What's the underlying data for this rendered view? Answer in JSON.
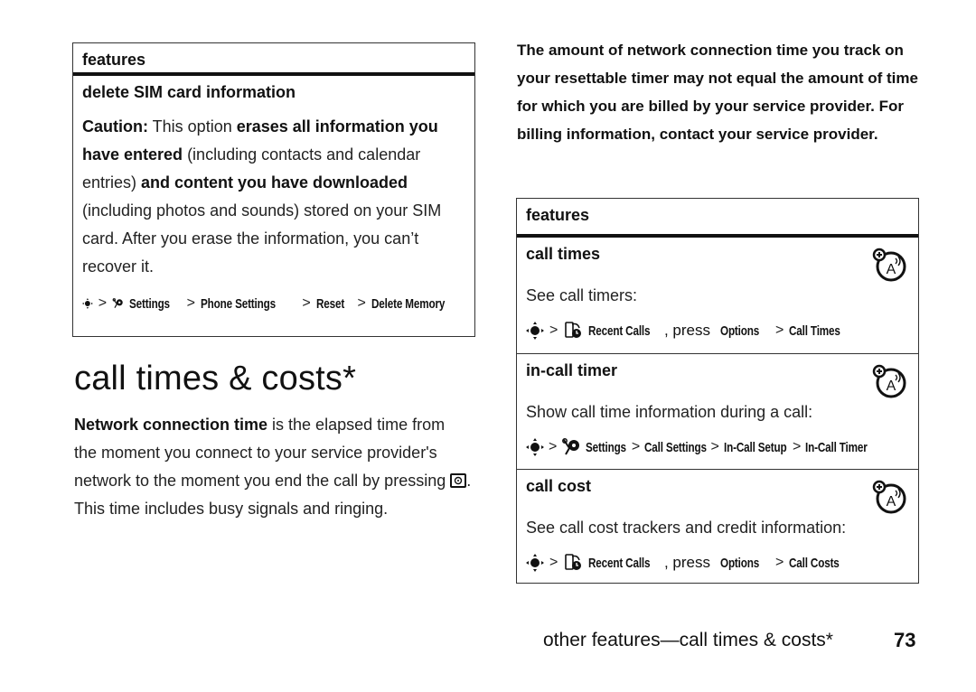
{
  "left_box": {
    "header": "features",
    "item_title": "delete SIM card information",
    "caution_label": "Caution:",
    "text_1": " This option ",
    "bold_1": "erases all information you have entered",
    "text_2": " (including contacts and calendar entries) ",
    "bold_2": "and content you have downloaded",
    "text_3": " (including photos and sounds) stored on your SIM card. After you erase the information, you can’t recover it.",
    "path": [
      "Settings",
      "Phone Settings",
      "Reset",
      "Delete Memory"
    ],
    "path_icons": [
      "nav-key-icon",
      "settings-icon"
    ]
  },
  "section": {
    "title": "call times & costs*",
    "intro_bold": "Network connection time",
    "intro_text_1": " is the elapsed time from the moment you connect to your service provider's network to the moment you end the call by pressing ",
    "intro_key_icon": "end-key-icon",
    "intro_text_2": ". This time includes busy signals and ringing."
  },
  "note": "The amount of network connection time you track on your resettable timer may not equal the amount of time for which you are billed by your service provider. For billing information, contact your service provider.",
  "right_box": {
    "header": "features",
    "rows": [
      {
        "title": "call times",
        "desc": "See call timers:",
        "icon": "network-dependent-icon",
        "path_lead_icon": "recent-calls-icon",
        "path_first": "Recent Calls",
        "press": ", press ",
        "path_rest": [
          "Options",
          "Call Times"
        ]
      },
      {
        "title": "in-call timer",
        "desc": "Show call time information during a call:",
        "icon": "network-dependent-icon",
        "path_lead_icon": "settings-icon",
        "path": [
          "Settings",
          "Call Settings",
          "In-Call Setup",
          "In-Call Timer"
        ]
      },
      {
        "title": "call cost",
        "desc": "See call cost trackers and credit information:",
        "icon": "network-dependent-icon",
        "path_lead_icon": "recent-calls-icon",
        "path_first": "Recent Calls",
        "press": ", press ",
        "path_rest": [
          "Options",
          "Call Costs"
        ]
      }
    ]
  },
  "footer": {
    "text": "other features—call times & costs*",
    "page_number": "73"
  },
  "separator": ">"
}
